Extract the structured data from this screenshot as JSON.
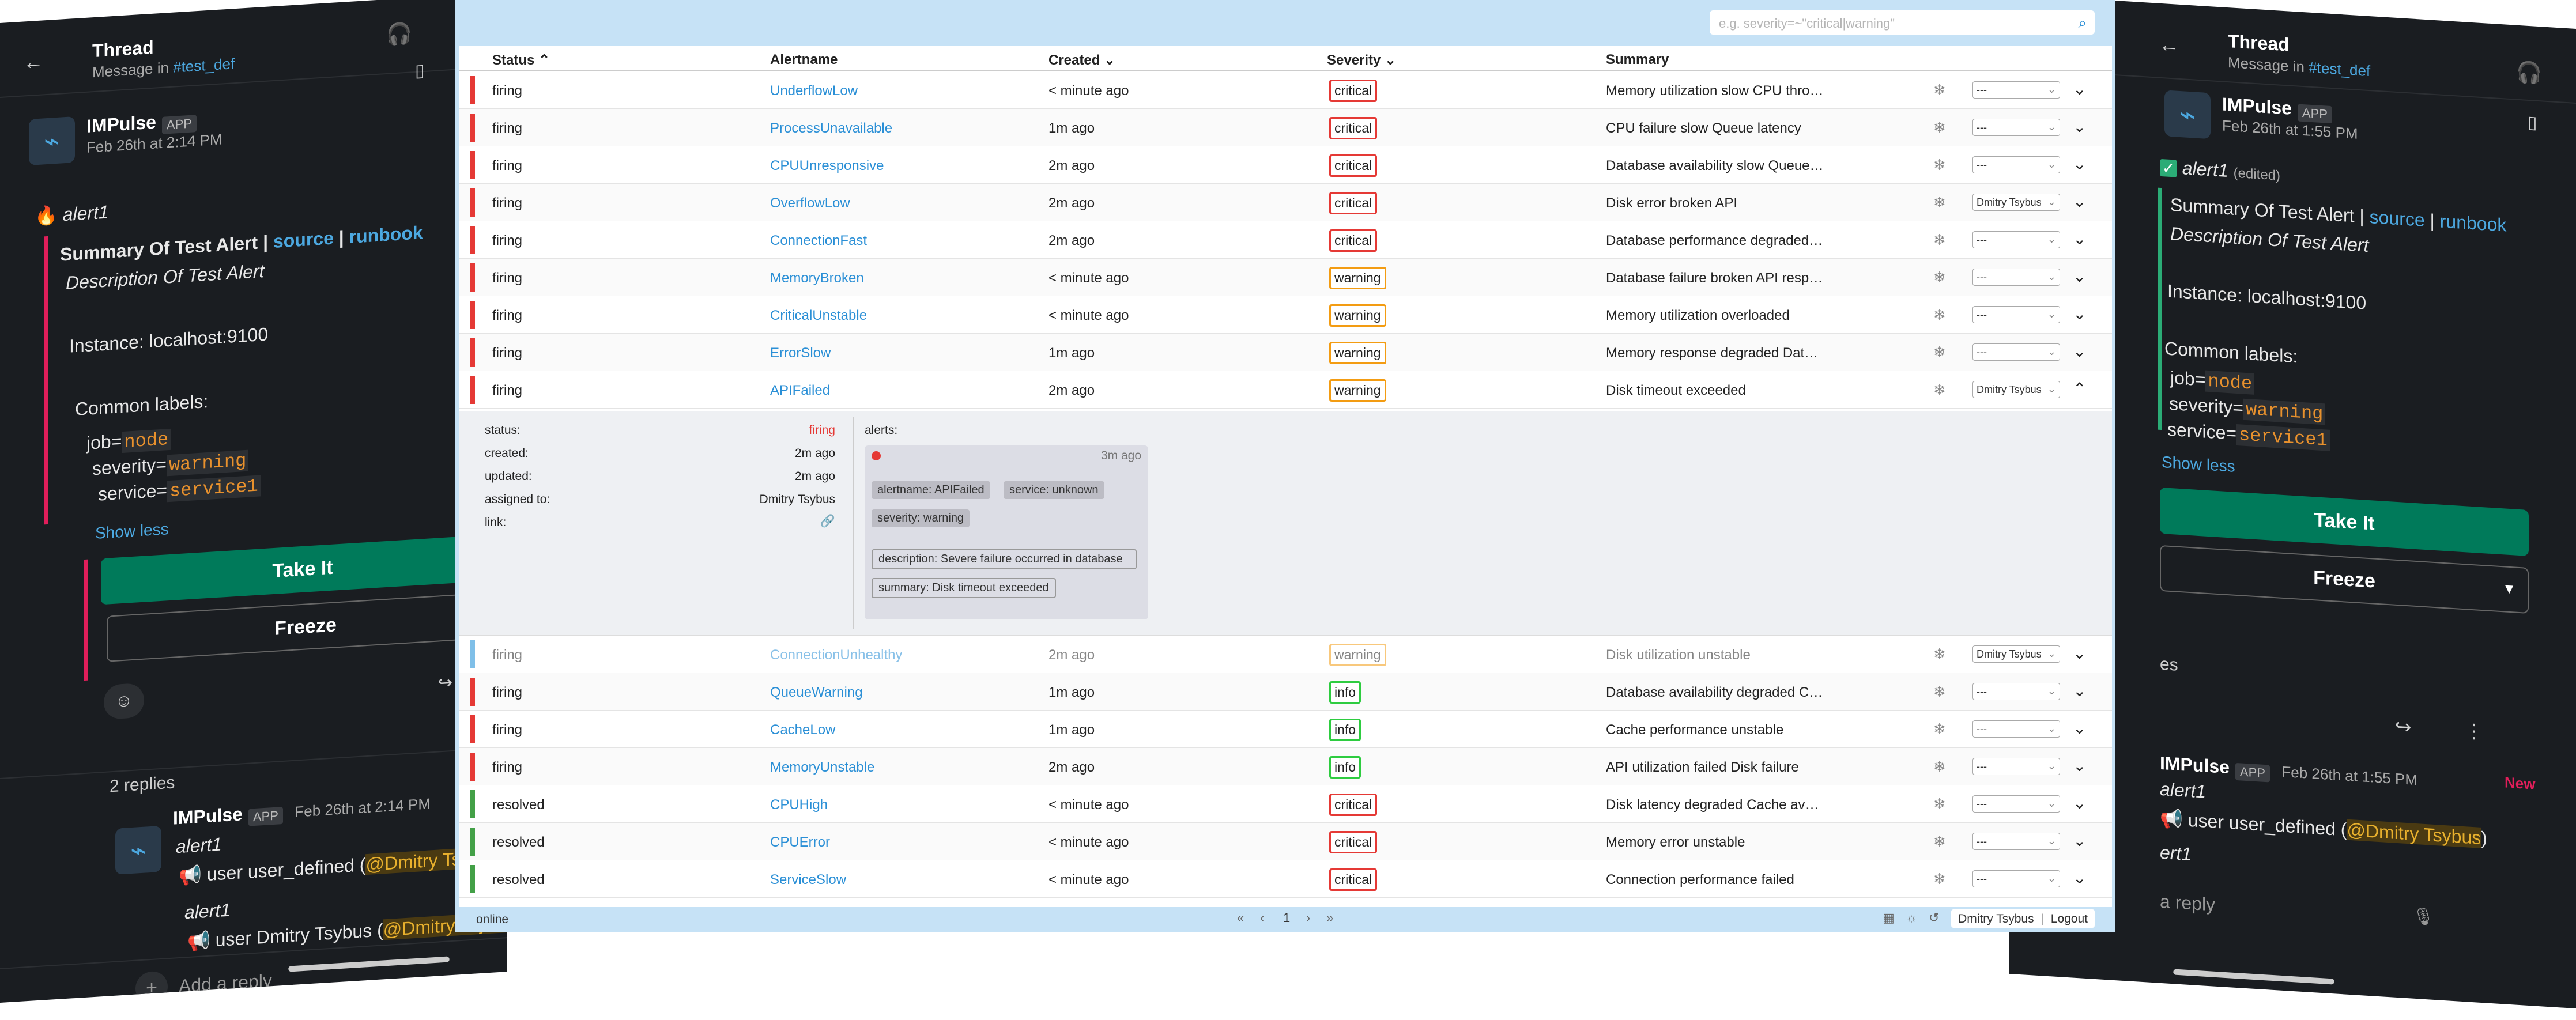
{
  "left_phone": {
    "header_title": "Thread",
    "header_sub_prefix": "Message in",
    "header_channel": "#test_def",
    "bot_name": "IMPulse",
    "app_badge": "APP",
    "post_time": "Feb 26th at 2:14 PM",
    "alert_name": "alert1",
    "summary_title": "Summary Of Test Alert",
    "source_link": "source",
    "runbook_link": "runbook",
    "separator": "|",
    "description": "Description Of Test Alert",
    "instance_label": "Instance:",
    "instance_value": "localhost:9100",
    "common_labels": "Common labels:",
    "label_job_key": "job=",
    "label_job_val": "node",
    "label_sev_key": "severity=",
    "label_sev_val": "warning",
    "label_svc_key": "service=",
    "label_svc_val": "service1",
    "show_less": "Show less",
    "take_it": "Take It",
    "freeze": "Freeze",
    "replies_count": "2 replies",
    "reply_time": "Feb 26th at 2:14 PM",
    "reply1_alert": "alert1",
    "reply1_text": "user user_defined (",
    "reply1_mention": "@Dmitry Tsybus",
    "reply2_alert": "alert1",
    "reply2_text": "user Dmitry Tsybus (",
    "reply2_mention": "@Dmitry Tsybus",
    "add_reply": "Add a reply"
  },
  "right_phone": {
    "header_title": "Thread",
    "header_sub_prefix": "Message in",
    "header_channel": "#test_def",
    "bot_name": "IMPulse",
    "app_badge": "APP",
    "post_time": "Feb 26th at 1:55 PM",
    "alert_name": "alert1",
    "edited": "(edited)",
    "summary_title": "Summary Of Test Alert",
    "source_link": "source",
    "runbook_link": "runbook",
    "separator": "|",
    "description": "Description Of Test Alert",
    "instance_label": "Instance:",
    "instance_value": "localhost:9100",
    "common_labels": "Common labels:",
    "label_job_key": "job=",
    "label_job_val": "node",
    "label_sev_key": "severity=",
    "label_sev_val": "warning",
    "label_svc_key": "service=",
    "label_svc_val": "service1",
    "show_less": "Show less",
    "take_it": "Take It",
    "freeze": "Freeze",
    "replies_fragment": "es",
    "reply_time": "Feb 26th at 1:55 PM",
    "new_badge": "New",
    "reply1_alert": "alert1",
    "reply1_text": "user user_defined (",
    "reply1_mention": "@Dmitry Tsybus",
    "reply1_end": ")",
    "reply2_alert": "ert1",
    "add_reply": "a reply"
  },
  "app": {
    "search_placeholder": "e.g. severity=~\"critical|warning\"",
    "columns": {
      "status": "Status",
      "alertname": "Alertname",
      "created": "Created",
      "severity": "Severity",
      "summary": "Summary"
    },
    "rows": [
      {
        "status": "firing",
        "name": "UnderflowLow",
        "created": "< minute ago",
        "severity": "critical",
        "summary": "Memory utilization slow CPU thro…",
        "assignee": "---",
        "color": "#e53935"
      },
      {
        "status": "firing",
        "name": "ProcessUnavailable",
        "created": "1m ago",
        "severity": "critical",
        "summary": "CPU failure slow Queue latency",
        "assignee": "---",
        "color": "#e53935"
      },
      {
        "status": "firing",
        "name": "CPUUnresponsive",
        "created": "2m ago",
        "severity": "critical",
        "summary": "Database availability slow Queue…",
        "assignee": "---",
        "color": "#e53935"
      },
      {
        "status": "firing",
        "name": "OverflowLow",
        "created": "2m ago",
        "severity": "critical",
        "summary": "Disk error broken API",
        "assignee": "Dmitry Tsybus",
        "color": "#e53935"
      },
      {
        "status": "firing",
        "name": "ConnectionFast",
        "created": "2m ago",
        "severity": "critical",
        "summary": "Database performance degraded…",
        "assignee": "---",
        "color": "#e53935"
      },
      {
        "status": "firing",
        "name": "MemoryBroken",
        "created": "< minute ago",
        "severity": "warning",
        "summary": "Database failure broken API resp…",
        "assignee": "---",
        "color": "#e53935"
      },
      {
        "status": "firing",
        "name": "CriticalUnstable",
        "created": "< minute ago",
        "severity": "warning",
        "summary": "Memory utilization overloaded",
        "assignee": "---",
        "color": "#e53935"
      },
      {
        "status": "firing",
        "name": "ErrorSlow",
        "created": "1m ago",
        "severity": "warning",
        "summary": "Memory response degraded Dat…",
        "assignee": "---",
        "color": "#e53935"
      },
      {
        "status": "firing",
        "name": "APIFailed",
        "created": "2m ago",
        "severity": "warning",
        "summary": "Disk timeout exceeded",
        "assignee": "Dmitry Tsybus",
        "color": "#e53935"
      }
    ],
    "rows_after": [
      {
        "status": "firing",
        "name": "ConnectionUnhealthy",
        "created": "2m ago",
        "severity": "warning",
        "summary": "Disk utilization unstable",
        "assignee": "Dmitry Tsybus",
        "color": "#7fbfe8"
      },
      {
        "status": "firing",
        "name": "QueueWarning",
        "created": "1m ago",
        "severity": "info",
        "summary": "Database availability degraded C…",
        "assignee": "---",
        "color": "#e53935"
      },
      {
        "status": "firing",
        "name": "CacheLow",
        "created": "1m ago",
        "severity": "info",
        "summary": "Cache performance unstable",
        "assignee": "---",
        "color": "#e53935"
      },
      {
        "status": "firing",
        "name": "MemoryUnstable",
        "created": "2m ago",
        "severity": "info",
        "summary": "API utilization failed Disk failure",
        "assignee": "---",
        "color": "#e53935"
      },
      {
        "status": "resolved",
        "name": "CPUHigh",
        "created": "< minute ago",
        "severity": "critical",
        "summary": "Disk latency degraded Cache av…",
        "assignee": "---",
        "color": "#43a047"
      },
      {
        "status": "resolved",
        "name": "CPUError",
        "created": "< minute ago",
        "severity": "critical",
        "summary": "Memory error unstable",
        "assignee": "---",
        "color": "#43a047"
      },
      {
        "status": "resolved",
        "name": "ServiceSlow",
        "created": "< minute ago",
        "severity": "critical",
        "summary": "Connection performance failed",
        "assignee": "---",
        "color": "#43a047"
      }
    ],
    "detail": {
      "status_label": "status:",
      "status_value": "firing",
      "created_label": "created:",
      "created_value": "2m ago",
      "updated_label": "updated:",
      "updated_value": "2m ago",
      "assigned_label": "assigned to:",
      "assigned_value": "Dmitry Tsybus",
      "link_label": "link:",
      "alerts_label": "alerts:",
      "card_time": "3m ago",
      "tag1": "alertname: APIFailed",
      "tag2": "service: unknown",
      "tag3": "severity: warning",
      "desc": "description: Severe failure occurred in database",
      "summary": "summary: Disk timeout exceeded"
    },
    "footer": {
      "status": "online",
      "page": "1",
      "user": "Dmitry Tsybus",
      "sep": "|",
      "logout": "Logout"
    }
  }
}
